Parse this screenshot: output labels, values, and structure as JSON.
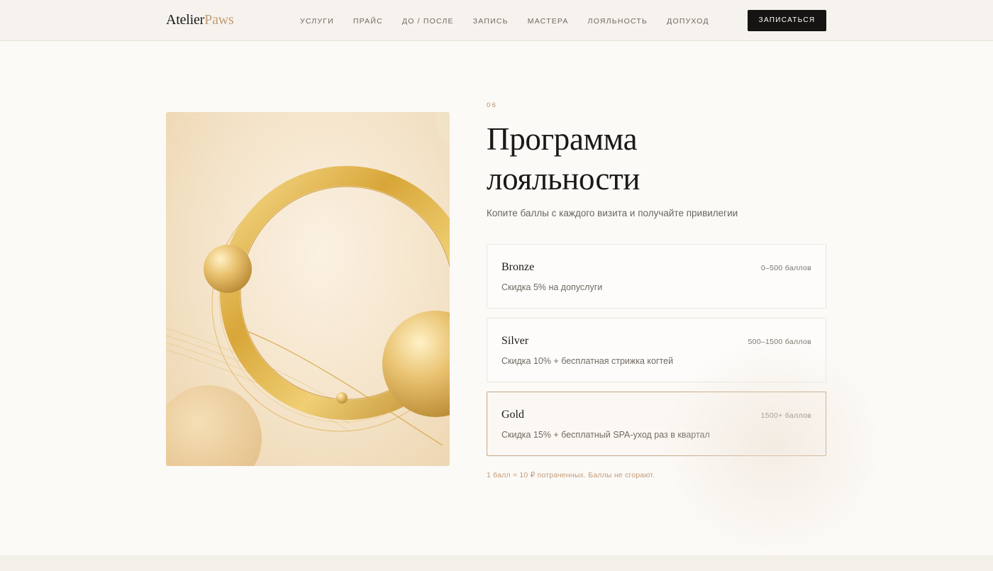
{
  "header": {
    "logo_part1": "Atelier",
    "logo_part2": "Paws",
    "nav": [
      "УСЛУГИ",
      "ПРАЙС",
      "ДО / ПОСЛЕ",
      "ЗАПИСЬ",
      "МАСТЕРА",
      "ЛОЯЛЬНОСТЬ",
      "ДОПУХОД"
    ],
    "cta_label": "ЗАПИСАТЬСЯ"
  },
  "section": {
    "number": "06",
    "title_line1": "Программа",
    "title_line2": "лояльности",
    "subtitle": "Копите баллы с каждого визита и получайте привилегии"
  },
  "tiers": [
    {
      "name": "Bronze",
      "range": "0–500 баллов",
      "description": "Скидка 5% на допуслуги"
    },
    {
      "name": "Silver",
      "range": "500–1500 баллов",
      "description": "Скидка 10% + бесплатная стрижка когтей"
    },
    {
      "name": "Gold",
      "range": "1500+ баллов",
      "description": "Скидка 15% + бесплатный SPA-уход раз в квартал"
    }
  ],
  "note": "1 балл = 10 ₽ потраченных. Баллы не сгорают.",
  "colors": {
    "accent": "#c29a72",
    "cta_bg": "#161412",
    "gold_border": "#c7a583",
    "page_bg": "#fcfaf7"
  },
  "art_image": "gold-ring-spheres-illustration"
}
